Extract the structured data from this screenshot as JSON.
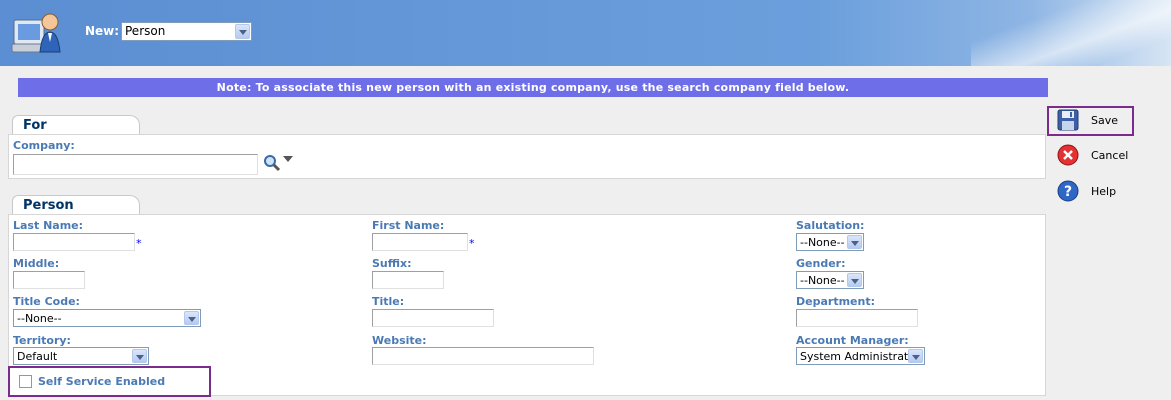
{
  "header": {
    "new_label": "New:",
    "new_select_value": "Person",
    "logo_icon": "person-computer-icon"
  },
  "note": "Note: To associate this new person with an existing company, use the search company field below.",
  "for_section": {
    "tab": "For",
    "company_label": "Company:",
    "company_value": "",
    "search_icon": "magnifier-icon"
  },
  "person_section": {
    "tab": "Person",
    "last_name_label": "Last Name:",
    "first_name_label": "First Name:",
    "salutation_label": "Salutation:",
    "salutation_value": "--None--",
    "middle_label": "Middle:",
    "suffix_label": "Suffix:",
    "gender_label": "Gender:",
    "gender_value": "--None--",
    "title_code_label": "Title Code:",
    "title_code_value": "--None--",
    "title_label": "Title:",
    "department_label": "Department:",
    "territory_label": "Territory:",
    "territory_value": "Default",
    "website_label": "Website:",
    "account_manager_label": "Account Manager:",
    "account_manager_value": "System Administrator",
    "self_service_label": "Self Service Enabled",
    "required_marker": "*"
  },
  "actions": {
    "save": "Save",
    "cancel": "Cancel",
    "help": "Help"
  },
  "colors": {
    "note_bar": "#6e6ee8",
    "label": "#4a7ab4",
    "highlight_box": "#7b2b8c"
  }
}
